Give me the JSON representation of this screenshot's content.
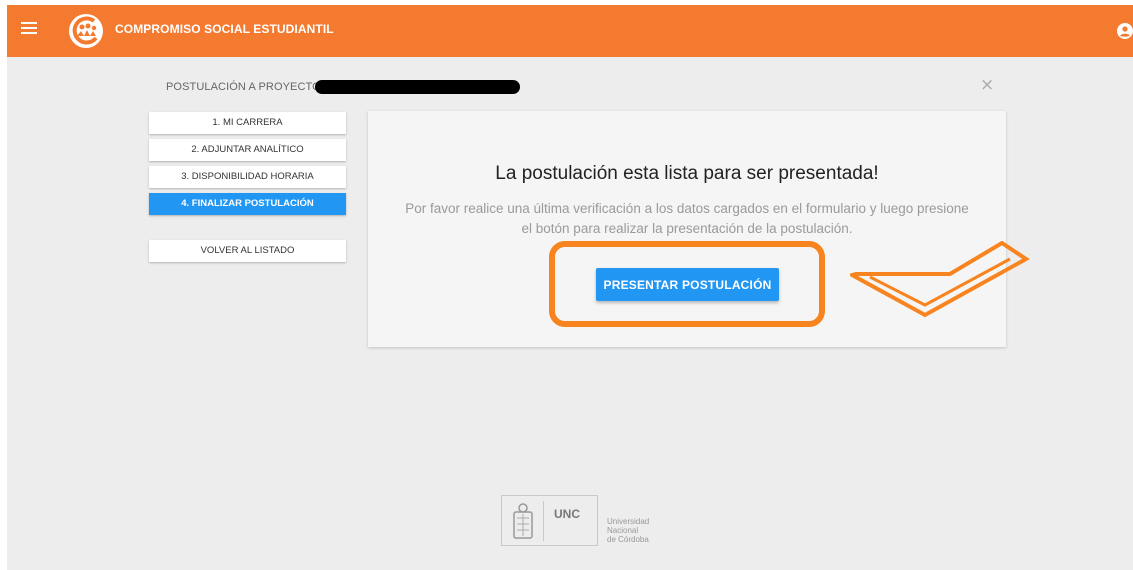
{
  "header": {
    "title": "COMPROMISO SOCIAL ESTUDIANTIL",
    "menu_icon": "hamburger-menu-icon",
    "logo_icon": "logo-icon",
    "user_icon": "user-account-icon",
    "color": "#f47a30"
  },
  "project": {
    "heading": "POSTULACIÓN A PROYECTO:",
    "close_icon": "close-icon",
    "close_glyph": "×"
  },
  "steps": [
    {
      "label": "1. MI CARRERA",
      "active": false
    },
    {
      "label": "2. ADJUNTAR ANALÍTICO",
      "active": false
    },
    {
      "label": "3. DISPONIBILIDAD HORARIA",
      "active": false
    },
    {
      "label": "4. FINALIZAR POSTULACIÓN",
      "active": true
    }
  ],
  "back_button": {
    "label": "VOLVER AL LISTADO"
  },
  "card": {
    "title": "La postulación esta lista para ser presentada!",
    "text": "Por favor realice una última verificación a los datos cargados en el formulario y luego presione el botón para realizar la presentación de la postulación.",
    "button_label": "PRESENTAR POSTULACIÓN",
    "button_color": "#2196f3"
  },
  "annotation": {
    "highlight_color": "#f7841f"
  },
  "footer": {
    "abbr": "UNC",
    "university_lines": [
      "Universidad",
      "Nacional",
      "de Córdoba"
    ]
  }
}
